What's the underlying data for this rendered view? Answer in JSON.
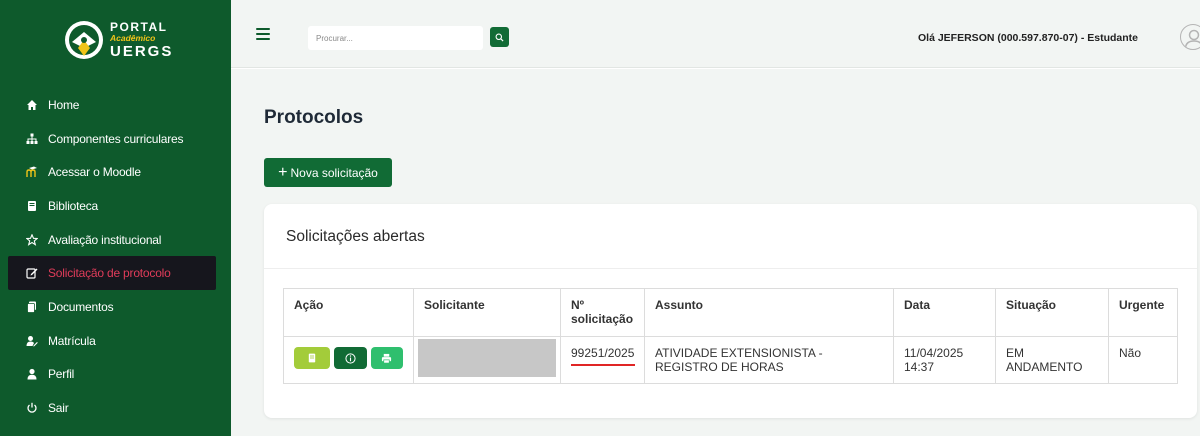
{
  "logo": {
    "line1": "PORTAL",
    "line2": "Acadêmico",
    "line3": "UERGS"
  },
  "colors": {
    "sidebar": "#0e5a2c",
    "primary": "#116b35",
    "active_text": "#e03c5a",
    "danger_underline": "#e02525"
  },
  "sidebar": {
    "items": [
      {
        "label": "Home",
        "icon": "home-icon"
      },
      {
        "label": "Componentes curriculares",
        "icon": "sitemap-icon"
      },
      {
        "label": "Acessar o Moodle",
        "icon": "moodle-icon"
      },
      {
        "label": "Biblioteca",
        "icon": "book-icon"
      },
      {
        "label": "Avaliação institucional",
        "icon": "star-icon"
      },
      {
        "label": "Solicitação de protocolo",
        "icon": "edit-icon",
        "active": true
      },
      {
        "label": "Documentos",
        "icon": "documents-icon"
      },
      {
        "label": "Matrícula",
        "icon": "user-edit-icon"
      },
      {
        "label": "Perfil",
        "icon": "user-icon"
      },
      {
        "label": "Sair",
        "icon": "power-icon"
      }
    ]
  },
  "topbar": {
    "search_placeholder": "Procurar...",
    "greeting": "Olá JEFERSON (000.597.870-07) - Estudante"
  },
  "main": {
    "title": "Protocolos",
    "new_button": "Nova solicitação",
    "card_title": "Solicitações abertas",
    "table": {
      "headers": [
        "Ação",
        "Solicitante",
        "Nº solicitação",
        "Assunto",
        "Data",
        "Situação",
        "Urgente"
      ],
      "rows": [
        {
          "solicitante": "",
          "numero": "99251/2025",
          "assunto": "ATIVIDADE EXTENSIONISTA - REGISTRO DE HORAS",
          "data": "11/04/2025 14:37",
          "situacao": "EM ANDAMENTO",
          "urgente": "Não",
          "actions": [
            "document-icon",
            "info-icon",
            "print-icon"
          ]
        }
      ]
    }
  }
}
